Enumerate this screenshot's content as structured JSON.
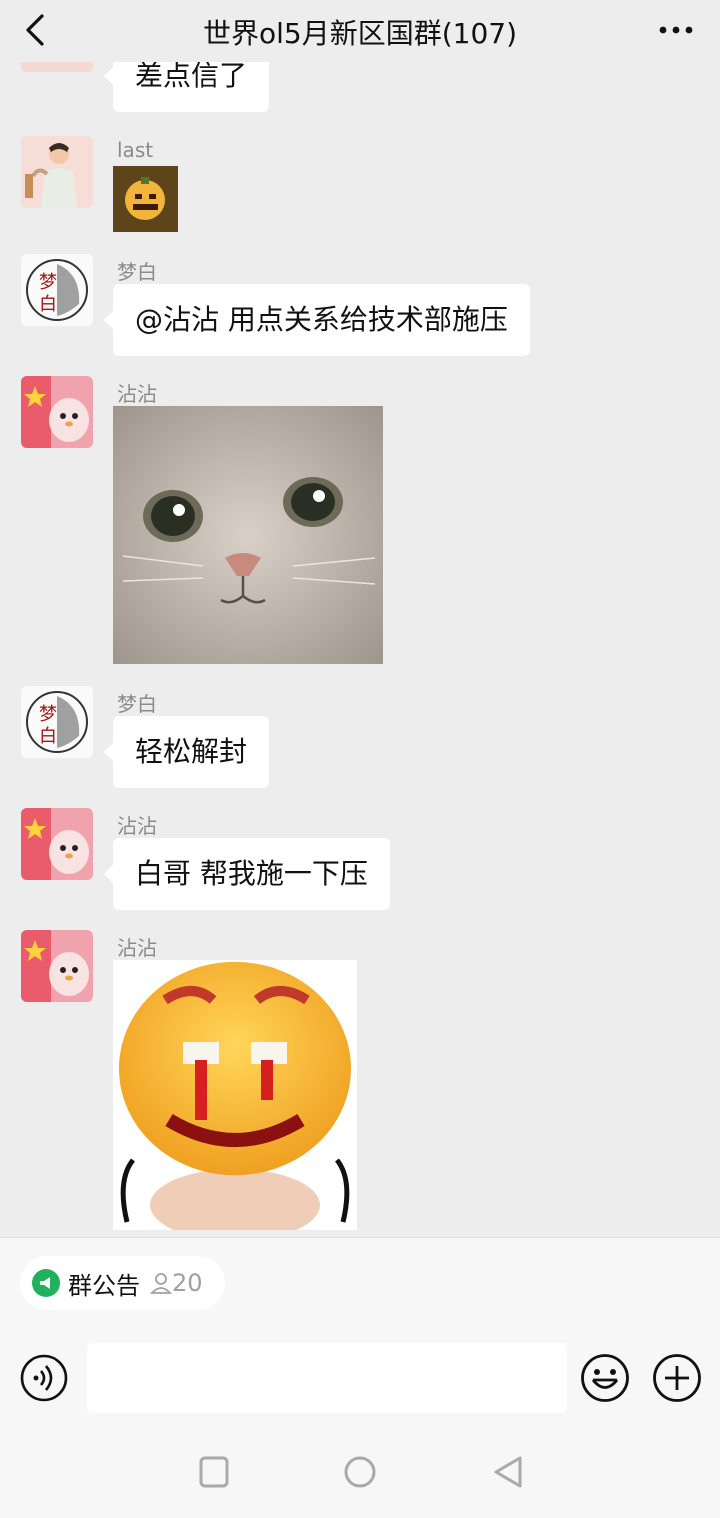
{
  "header": {
    "title": "世界ol5月新区国群(107)"
  },
  "messages": [
    {
      "type": "text",
      "sender": "",
      "text": "差点信了"
    },
    {
      "type": "sticker",
      "sender": "last",
      "sticker": "pumpkin-emoji-sticker"
    },
    {
      "type": "text",
      "sender": "梦白",
      "text": "@沾沾  用点关系给技术部施压"
    },
    {
      "type": "sticker",
      "sender": "沾沾",
      "sticker": "crying-cat-sticker"
    },
    {
      "type": "text",
      "sender": "梦白",
      "text": "轻松解封"
    },
    {
      "type": "text",
      "sender": "沾沾",
      "text": "白哥  帮我施一下压"
    },
    {
      "type": "sticker",
      "sender": "沾沾",
      "sticker": "bleeding-emoji-sticker"
    }
  ],
  "notice_bar": {
    "label": "群公告",
    "count": "20"
  },
  "input": {
    "placeholder": ""
  },
  "icons": {
    "back": "chevron-left-icon",
    "more": "more-dots-icon",
    "voice": "voice-icon",
    "emoji": "emoji-icon",
    "plus": "plus-icon",
    "nav_square": "recent-apps-icon",
    "nav_circle": "home-icon",
    "nav_triangle": "back-triangle-icon"
  },
  "colors": {
    "background": "#ededed",
    "bubble": "#ffffff",
    "accent_green": "#20b15a"
  }
}
